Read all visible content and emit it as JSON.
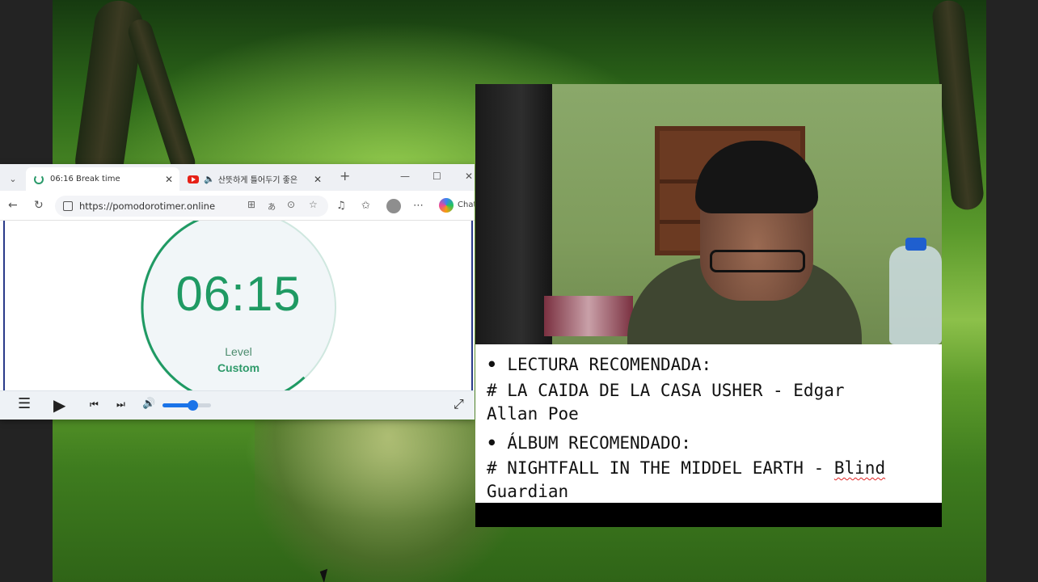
{
  "browser": {
    "tabs": [
      {
        "label": "06:16 Break time"
      },
      {
        "label": "산뜻하게 틀어두기 좋은"
      }
    ],
    "url": "https://pomodorotimer.online",
    "chat_label": "Chat",
    "new_tab_symbol": "+",
    "window_controls": {
      "minimize": "—",
      "maximize": "☐",
      "close": "✕"
    }
  },
  "timer": {
    "time": "06:15",
    "level_label": "Level",
    "level_value": "Custom",
    "progress_fraction": 0.62,
    "accent": "#1f9a63"
  },
  "player": {
    "volume_fraction": 0.62
  },
  "notes": {
    "lines": [
      {
        "bullet": "•",
        "text": "LECTURA RECOMENDADA:"
      },
      {
        "text": "# LA CAIDA DE LA CASA USHER - Edgar"
      },
      {
        "text": "Allan Poe"
      },
      {
        "bullet": "•",
        "text": "ÁLBUM RECOMENDADO:"
      },
      {
        "text_before": "# NIGHTFALL IN THE MIDDEL EARTH - ",
        "text_flagged": "Blind"
      },
      {
        "text": "Guardian"
      }
    ]
  },
  "icons": {
    "tab_list": "chevron-down-icon",
    "back": "back-arrow-icon",
    "refresh": "refresh-icon",
    "play": "play-icon",
    "volume": "speaker-icon",
    "fullscreen": "expand-icon"
  }
}
